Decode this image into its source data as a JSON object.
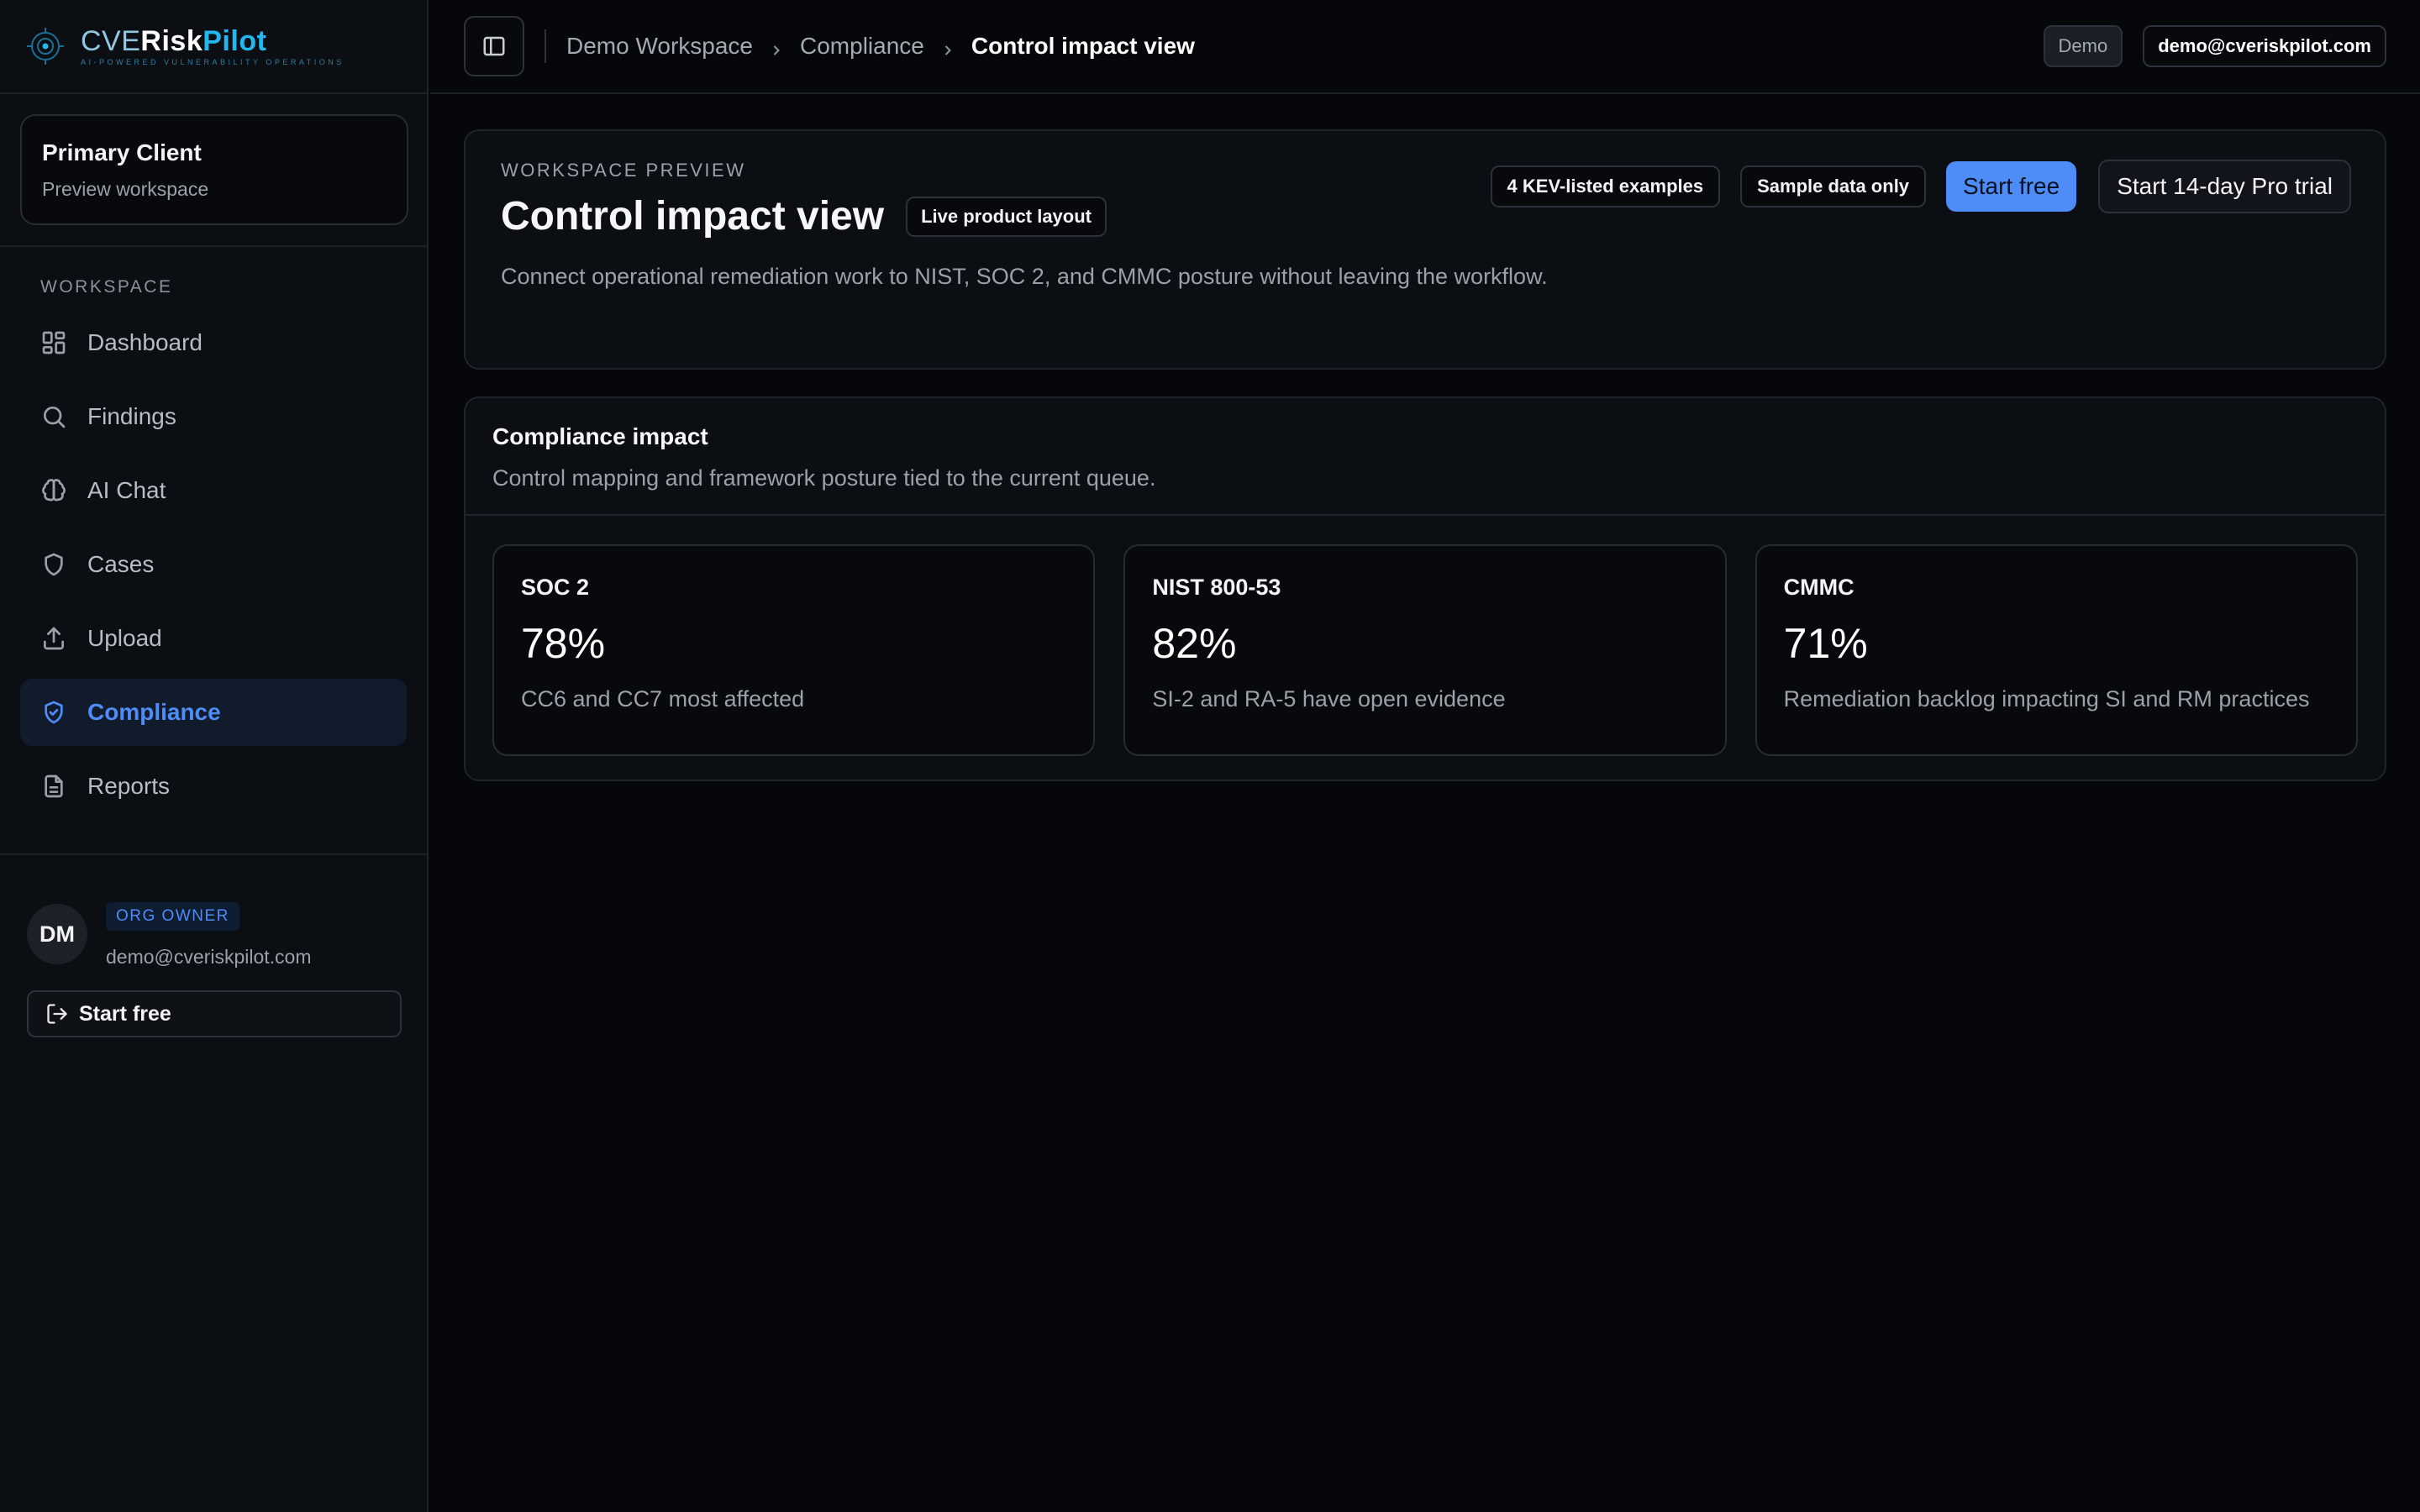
{
  "brand": {
    "name_part1": "CVE",
    "name_part2": "Risk",
    "name_part3": "Pilot",
    "tagline": "AI-POWERED VULNERABILITY OPERATIONS",
    "logo_icon": "target-logo-icon",
    "accent_color": "#22b8ef"
  },
  "client": {
    "name": "Primary Client",
    "subtitle": "Preview workspace"
  },
  "sidebar": {
    "section_heading": "WORKSPACE",
    "items": [
      {
        "label": "Dashboard",
        "icon": "grid-icon",
        "active": false
      },
      {
        "label": "Findings",
        "icon": "search-icon",
        "active": false
      },
      {
        "label": "AI Chat",
        "icon": "brain-icon",
        "active": false
      },
      {
        "label": "Cases",
        "icon": "shield-icon",
        "active": false
      },
      {
        "label": "Upload",
        "icon": "upload-icon",
        "active": false
      },
      {
        "label": "Compliance",
        "icon": "shield-check-icon",
        "active": true
      },
      {
        "label": "Reports",
        "icon": "document-icon",
        "active": false
      }
    ],
    "active_color": "#4e8df7"
  },
  "user": {
    "initials": "DM",
    "role": "ORG OWNER",
    "email": "demo@cveriskpilot.com",
    "signout_label": "Start free",
    "signout_icon": "sign-out-icon"
  },
  "topbar": {
    "toggle_icon": "sidebar-toggle-icon",
    "breadcrumbs": [
      "Demo Workspace",
      "Compliance",
      "Control impact view"
    ],
    "demo_badge": "Demo",
    "email_button": "demo@cveriskpilot.com"
  },
  "hero": {
    "eyebrow": "WORKSPACE PREVIEW",
    "title": "Control impact view",
    "badge": "Live product layout",
    "description": "Connect operational remediation work to NIST, SOC 2, and CMMC posture without leaving the workflow.",
    "chips": [
      "4 KEV-listed examples",
      "Sample data only"
    ],
    "primary_button": "Start free",
    "secondary_button": "Start 14-day Pro trial",
    "primary_color": "#4e8df7"
  },
  "impact": {
    "title": "Compliance impact",
    "subtitle": "Control mapping and framework posture tied to the current queue.",
    "cards": [
      {
        "name": "SOC 2",
        "value": "78%",
        "note": "CC6 and CC7 most affected"
      },
      {
        "name": "NIST 800-53",
        "value": "82%",
        "note": "SI-2 and RA-5 have open evidence"
      },
      {
        "name": "CMMC",
        "value": "71%",
        "note": "Remediation backlog impacting SI and RM practices"
      }
    ]
  }
}
